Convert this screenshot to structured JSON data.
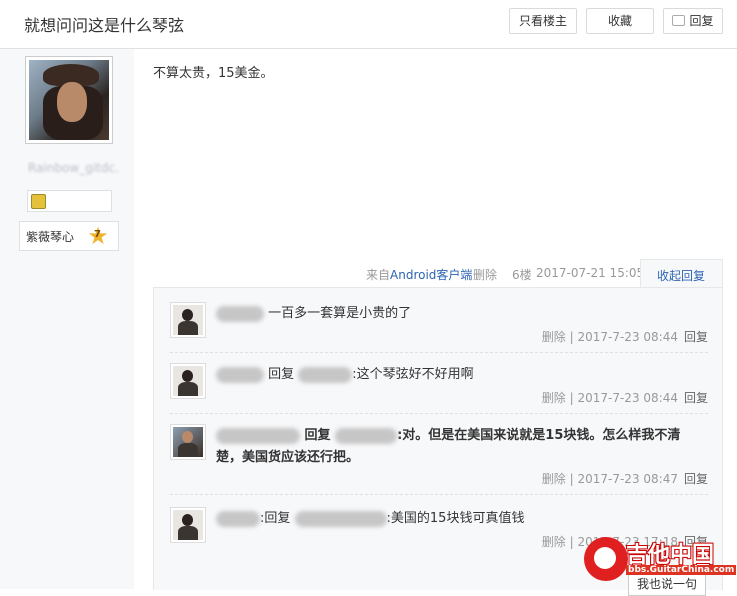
{
  "header": {
    "title": "就想问问这是什么琴弦",
    "btn_only_lz": "只看楼主",
    "btn_favorite": "收藏",
    "btn_reply": "回复"
  },
  "author": {
    "name": "Rainbow_gitdc.",
    "level_name": "紫薇琴心",
    "level_num": "7"
  },
  "post": {
    "content": "不算太贵，15美金。",
    "from_prefix": "来自",
    "from_app": "Android客户端",
    "delete": "删除",
    "floor": "6楼",
    "time": "2017-07-21 15:05",
    "collapse": "收起回复"
  },
  "replies": [
    {
      "text": "一百多一套算是小贵的了",
      "meta": "删除 | 2017-7-23 08:44",
      "reply": "回复"
    },
    {
      "prefix": "回复",
      "text": ":这个琴弦好不好用啊",
      "meta": "删除 | 2017-7-23 08:44",
      "reply": "回复"
    },
    {
      "prefix": "回复",
      "text": ":对。但是在美国来说就是15块钱。怎么样我不清楚，美国货应该还行把。",
      "meta": "删除 | 2017-7-23 08:47",
      "reply": "回复"
    },
    {
      "prefix": ":回复",
      "text": ":美国的15块钱可真值钱",
      "meta": "删除 | 2017-7-23 17:18",
      "reply": "回复"
    }
  ],
  "say_also": "我也说一句",
  "watermark": {
    "title": "吉他中国",
    "url": "bbs.GuitarChina.com"
  },
  "colors": {
    "link": "#2d64b3",
    "sidebar_bg": "#f7f8fa",
    "meta": "#999999"
  }
}
